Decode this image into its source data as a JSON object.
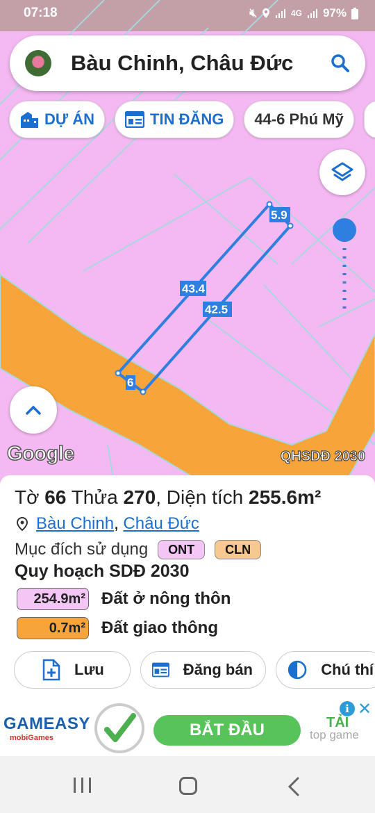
{
  "status_bar": {
    "time": "07:18",
    "battery": "97%",
    "network": "4G"
  },
  "search": {
    "title": "Bàu Chinh, Châu Đức"
  },
  "chips": [
    {
      "label": "DỰ ÁN",
      "icon": "building-icon"
    },
    {
      "label": "TIN ĐĂNG",
      "icon": "listing-icon"
    },
    {
      "label": "44-6 Phú Mỹ"
    }
  ],
  "map": {
    "edge_labels": [
      "43.4",
      "42.5",
      "5.9",
      "6"
    ],
    "logo": "Google",
    "layer_label": "QHSDĐ 2030"
  },
  "parcel": {
    "to_label": "Tờ",
    "to_value": "66",
    "thua_label": "Thửa",
    "thua_value": "270",
    "area_label": ", Diện tích",
    "area_value": "255.6m²",
    "ward": "Bàu Chinh",
    "separator": ",",
    "district": "Châu Đức",
    "purpose_label": "Mục đích sử dụng",
    "purpose_codes": [
      "ONT",
      "CLN"
    ],
    "plan_title": "Quy hoạch SDĐ 2030",
    "plan_rows": [
      {
        "value": "254.9m²",
        "label": "Đất ở nông thôn",
        "color": "#f3c6f5"
      },
      {
        "value": "0.7m²",
        "label": "Đất giao thông",
        "color": "#f7a53a"
      }
    ]
  },
  "actions": [
    {
      "label": "Lưu",
      "icon": "add-file-icon"
    },
    {
      "label": "Đăng bán",
      "icon": "listing-icon"
    },
    {
      "label": "Chú thí",
      "icon": "half-circle-icon"
    }
  ],
  "ad": {
    "brand": "GAMEASY",
    "sub": "mobiGames",
    "cta": "BẮT ĐẦU",
    "line1": "TẢI",
    "line2": "top game"
  },
  "colors": {
    "map_pink": "#f4b9f2",
    "road_orange": "#f7a53a",
    "brand_blue": "#1a6fd0",
    "parcel_line": "#2f7fe0"
  }
}
